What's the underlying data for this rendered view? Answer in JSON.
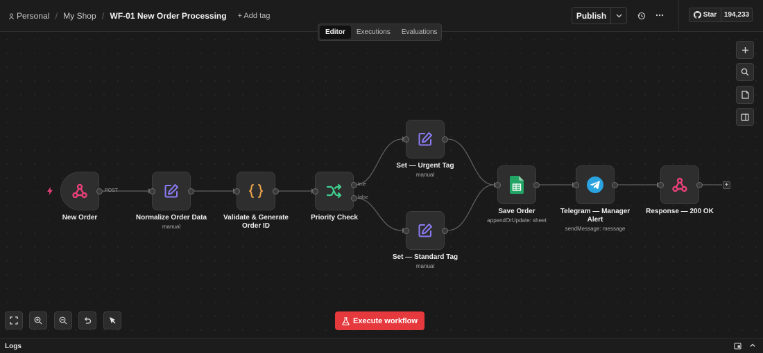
{
  "header": {
    "breadcrumb": [
      "Personal",
      "My Shop"
    ],
    "workflow_title": "WF-01 New Order Processing",
    "add_tag_label": "+ Add tag",
    "publish_label": "Publish",
    "github_star_label": "Star",
    "github_star_count": "194,233"
  },
  "tabs": [
    {
      "label": "Editor",
      "active": true
    },
    {
      "label": "Executions",
      "active": false
    },
    {
      "label": "Evaluations",
      "active": false
    }
  ],
  "nodes": {
    "new_order": {
      "label": "New Order",
      "icon": "webhook-icon"
    },
    "normalize": {
      "label": "Normalize Order Data",
      "sub": "manual",
      "icon": "edit-icon"
    },
    "validate": {
      "label_line1": "Validate & Generate",
      "label_line2": "Order ID",
      "icon": "code-braces-icon"
    },
    "priority": {
      "label": "Priority Check",
      "icon": "switch-branch-icon"
    },
    "urgent": {
      "label": "Set — Urgent Tag",
      "sub": "manual",
      "icon": "edit-icon"
    },
    "standard": {
      "label": "Set — Standard Tag",
      "sub": "manual",
      "icon": "edit-icon"
    },
    "save": {
      "label": "Save Order",
      "sub": "appendOrUpdate: sheet",
      "icon": "google-sheets-icon"
    },
    "telegram": {
      "label_line1": "Telegram — Manager",
      "label_line2": "Alert",
      "sub": "sendMessage: message",
      "icon": "telegram-icon"
    },
    "response": {
      "label": "Response — 200 OK",
      "icon": "webhook-icon"
    }
  },
  "edge_labels": {
    "post": "POST",
    "true": "true",
    "false": "false"
  },
  "execute_label": "Execute workflow",
  "logs_label": "Logs",
  "colors": {
    "webhook": "#e9407a",
    "edit": "#8b7cf6",
    "code": "#f0a64c",
    "switch": "#3fcf8e",
    "sheets": "#21a464",
    "telegram": "#2aa3df",
    "execute": "#e5393d"
  }
}
